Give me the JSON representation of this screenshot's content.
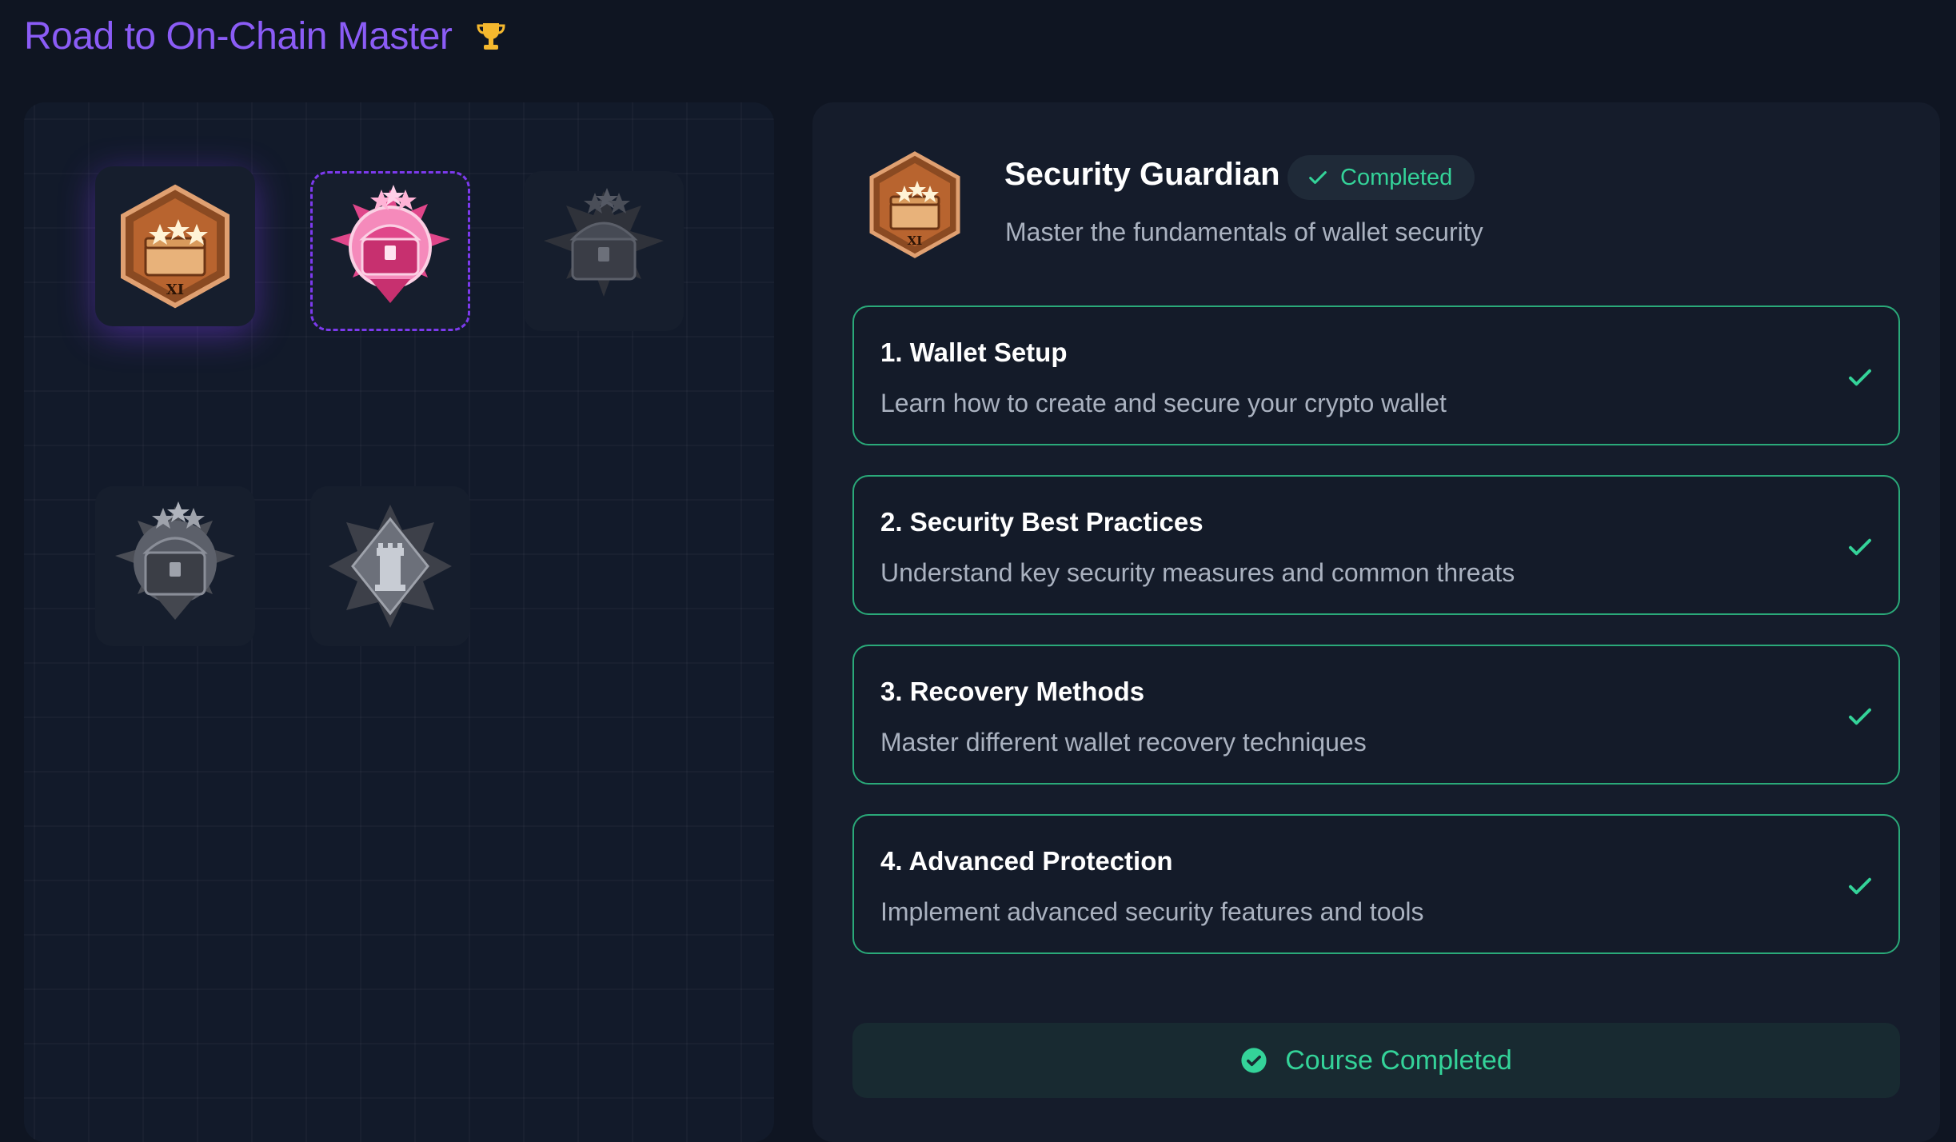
{
  "header": {
    "title": "Road to On-Chain Master",
    "icon": "trophy-icon"
  },
  "badges": [
    {
      "name": "hexagon-chest-badge-bronze",
      "state": "unlocked",
      "label": "XI"
    },
    {
      "name": "pink-chest-badge",
      "state": "selected"
    },
    {
      "name": "chest-badge-locked",
      "state": "locked"
    },
    {
      "name": "star-chest-badge-locked",
      "state": "locked"
    },
    {
      "name": "tower-badge-locked",
      "state": "locked"
    }
  ],
  "course": {
    "title": "Security Guardian",
    "status": "Completed",
    "subtitle": "Master the fundamentals of wallet security",
    "badge_label": "XI",
    "modules": [
      {
        "title": "1. Wallet Setup",
        "description": "Learn how to create and secure your crypto wallet",
        "done": true
      },
      {
        "title": "2. Security Best Practices",
        "description": "Understand key security measures and common threats",
        "done": true
      },
      {
        "title": "3. Recovery Methods",
        "description": "Master different wallet recovery techniques",
        "done": true
      },
      {
        "title": "4. Advanced Protection",
        "description": "Implement advanced security features and tools",
        "done": true
      }
    ],
    "completed_label": "Course Completed"
  },
  "colors": {
    "background": "#0f1522",
    "accent_purple": "#8b5cf6",
    "success_green": "#34d399",
    "trophy_gold": "#f5b82e"
  }
}
